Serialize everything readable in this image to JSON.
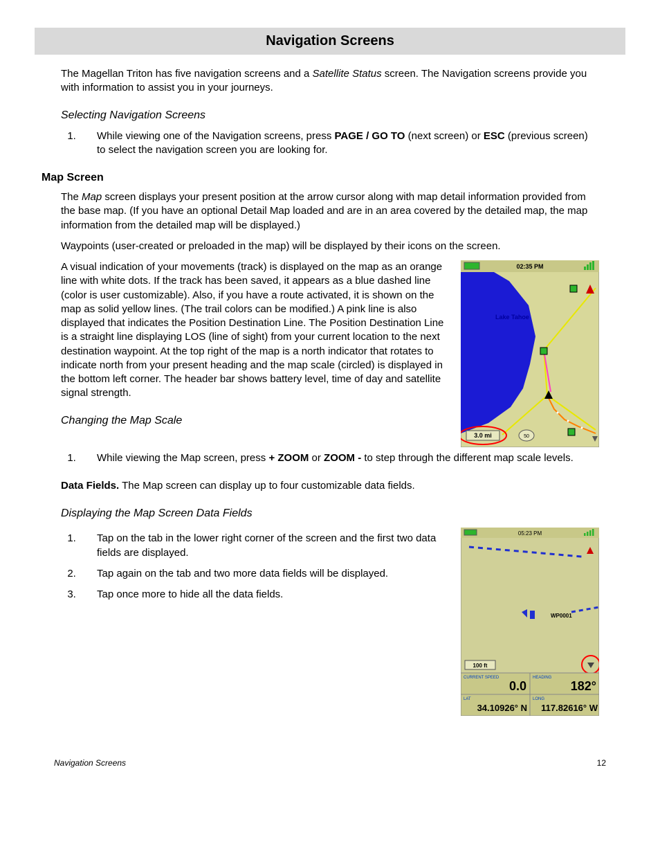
{
  "title": "Navigation Screens",
  "intro_a": "The Magellan Triton has five navigation screens and a ",
  "intro_b": "Satellite Status",
  "intro_c": " screen.  The Navigation screens provide you with information to assist you in your journeys.",
  "sect_select": "Selecting Navigation Screens",
  "select_li_a": "While viewing one of the Navigation screens, press ",
  "select_li_b": "PAGE / GO TO",
  "select_li_c": " (next screen) or ",
  "select_li_d": "ESC",
  "select_li_e": " (previous screen) to select the navigation screen you are looking for.",
  "sect_map": "Map Screen",
  "map_p1_a": "The ",
  "map_p1_b": "Map",
  "map_p1_c": " screen displays your present position at the arrow cursor along with map detail information provided from the base map.  (If you have an optional Detail Map loaded and are in an area covered by the detailed map, the map information from the detailed map will be displayed.)",
  "map_p2": "Waypoints (user-created or preloaded in the map) will be displayed by their icons on the screen.",
  "map_p3": "A visual indication of your movements (track) is displayed on the map as an orange line with white dots. If the track has been saved, it appears as a blue dashed line (color is user customizable).  Also, if you have a route activated, it is shown on the map as solid yellow lines. (The trail colors can be modified.)  A pink line is also displayed that indicates the Position Destination Line.  The Position Destination Line is a straight line displaying LOS (line of sight) from your current location to the next destination waypoint. At the top right of the map is a north indicator that rotates to indicate north from your present heading and the map scale (circled) is displayed in the bottom left corner.  The header bar shows battery level, time of day and satellite signal strength.",
  "sect_scale": "Changing the Map Scale",
  "scale_li_a": "While viewing the Map screen, press ",
  "scale_li_b": "+ ZOOM",
  "scale_li_c": " or ",
  "scale_li_d": "ZOOM -",
  "scale_li_e": " to step through the different map scale levels.",
  "datafields_a": "Data Fields.",
  "datafields_b": "  The Map screen can display up to four customizable data fields.",
  "sect_display": "Displaying the Map Screen Data Fields",
  "disp_li_1": "Tap on the tab in the lower right corner of the screen and the first two data fields are displayed.",
  "disp_li_2": "Tap again on the tab and two more data fields will be displayed.",
  "disp_li_3": "Tap once more to hide all the data fields.",
  "footer_left": "Navigation Screens",
  "footer_page": "12",
  "fig1": {
    "time": "02:35 PM",
    "lake_label": "Lake Tahoe",
    "scale": "3.0 mi"
  },
  "fig2": {
    "time": "05:23 PM",
    "wp_label": "WP0001",
    "scale": "100 ft",
    "speed_label": "CURRENT SPEED",
    "speed_val": "0.0",
    "heading_label": "HEADING",
    "heading_val": "182°",
    "lat_label": "LAT",
    "lat_val": "34.10926° N",
    "long_label": "LONG",
    "long_val": "117.82616° W"
  }
}
